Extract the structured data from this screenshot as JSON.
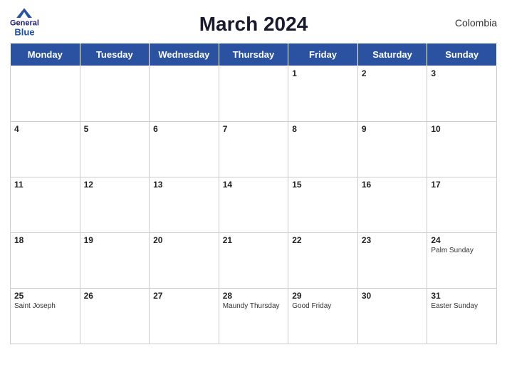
{
  "header": {
    "title": "March 2024",
    "country": "Colombia",
    "logo_general": "General",
    "logo_blue": "Blue"
  },
  "weekdays": [
    "Monday",
    "Tuesday",
    "Wednesday",
    "Thursday",
    "Friday",
    "Saturday",
    "Sunday"
  ],
  "weeks": [
    [
      {
        "day": null,
        "holiday": ""
      },
      {
        "day": null,
        "holiday": ""
      },
      {
        "day": null,
        "holiday": ""
      },
      {
        "day": null,
        "holiday": ""
      },
      {
        "day": "1",
        "holiday": ""
      },
      {
        "day": "2",
        "holiday": ""
      },
      {
        "day": "3",
        "holiday": ""
      }
    ],
    [
      {
        "day": "4",
        "holiday": ""
      },
      {
        "day": "5",
        "holiday": ""
      },
      {
        "day": "6",
        "holiday": ""
      },
      {
        "day": "7",
        "holiday": ""
      },
      {
        "day": "8",
        "holiday": ""
      },
      {
        "day": "9",
        "holiday": ""
      },
      {
        "day": "10",
        "holiday": ""
      }
    ],
    [
      {
        "day": "11",
        "holiday": ""
      },
      {
        "day": "12",
        "holiday": ""
      },
      {
        "day": "13",
        "holiday": ""
      },
      {
        "day": "14",
        "holiday": ""
      },
      {
        "day": "15",
        "holiday": ""
      },
      {
        "day": "16",
        "holiday": ""
      },
      {
        "day": "17",
        "holiday": ""
      }
    ],
    [
      {
        "day": "18",
        "holiday": ""
      },
      {
        "day": "19",
        "holiday": ""
      },
      {
        "day": "20",
        "holiday": ""
      },
      {
        "day": "21",
        "holiday": ""
      },
      {
        "day": "22",
        "holiday": ""
      },
      {
        "day": "23",
        "holiday": ""
      },
      {
        "day": "24",
        "holiday": "Palm Sunday"
      }
    ],
    [
      {
        "day": "25",
        "holiday": "Saint Joseph"
      },
      {
        "day": "26",
        "holiday": ""
      },
      {
        "day": "27",
        "holiday": ""
      },
      {
        "day": "28",
        "holiday": "Maundy Thursday"
      },
      {
        "day": "29",
        "holiday": "Good Friday"
      },
      {
        "day": "30",
        "holiday": ""
      },
      {
        "day": "31",
        "holiday": "Easter Sunday"
      }
    ]
  ]
}
